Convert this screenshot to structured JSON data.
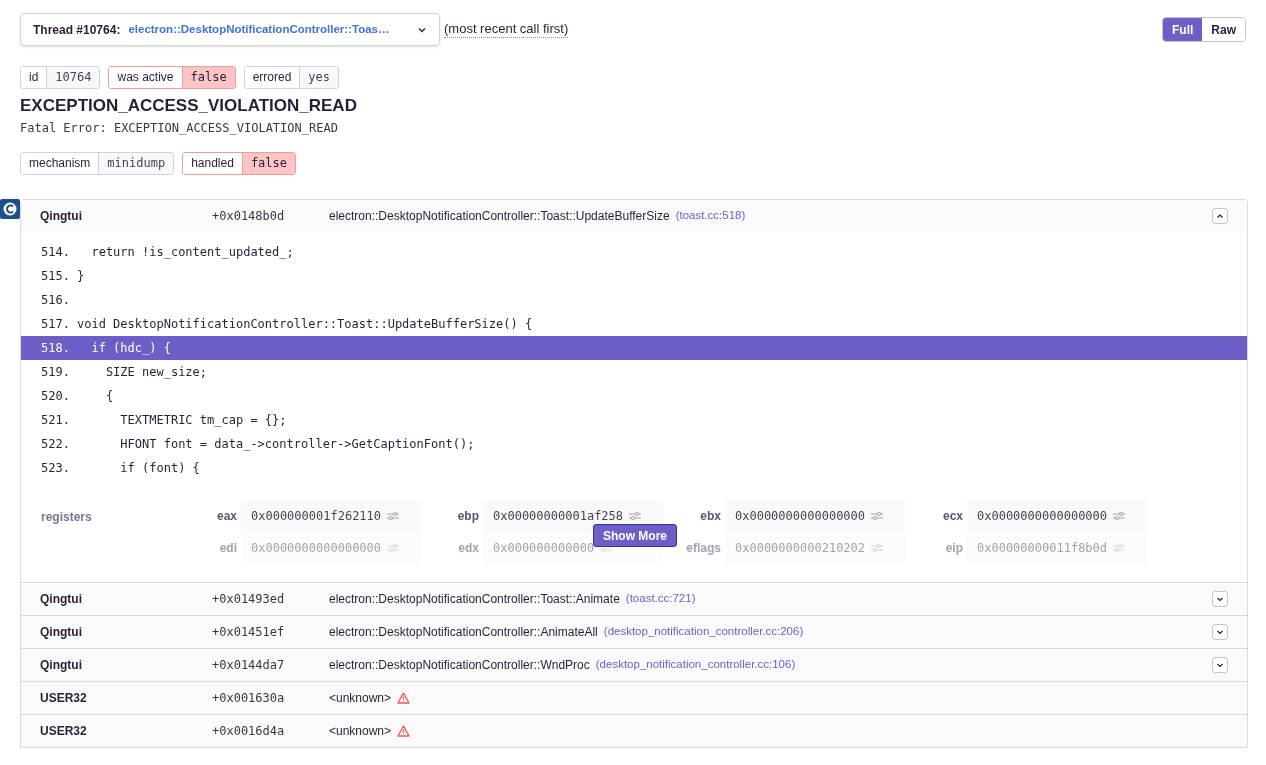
{
  "thread_selector": {
    "label": "Thread #10764:",
    "value": "electron::DesktopNotificationController::Toas…"
  },
  "order_note": "(most recent call first)",
  "view_toggle": [
    {
      "label": "Full",
      "selected": true
    },
    {
      "label": "Raw",
      "selected": false
    }
  ],
  "thread_tags": [
    {
      "key": "id",
      "value": "10764",
      "alert": false
    },
    {
      "key": "was active",
      "value": "false",
      "alert": true
    },
    {
      "key": "errored",
      "value": "yes",
      "alert": false
    }
  ],
  "exception": {
    "type": "EXCEPTION_ACCESS_VIOLATION_READ",
    "message": "Fatal Error: EXCEPTION_ACCESS_VIOLATION_READ"
  },
  "mechanism_tags": [
    {
      "key": "mechanism",
      "value": "minidump",
      "alert": false
    },
    {
      "key": "handled",
      "value": "false",
      "alert": true
    }
  ],
  "frames": [
    {
      "module": "Qingtui",
      "address": "+0x0148b0d",
      "function": "electron::DesktopNotificationController::Toast::UpdateBufferSize",
      "location": "(toast.cc:518)",
      "expanded": true,
      "unknown": false,
      "context": [
        {
          "line": "514.",
          "code": "  return !is_content_updated_;",
          "selected": false
        },
        {
          "line": "515.",
          "code": "}",
          "selected": false
        },
        {
          "line": "516.",
          "selected": false
        },
        {
          "line": "517.",
          "code": "void DesktopNotificationController::Toast::UpdateBufferSize() {",
          "selected": false
        },
        {
          "line": "518.",
          "code": "  if (hdc_) {",
          "selected": true
        },
        {
          "line": "519.",
          "code": "    SIZE new_size;",
          "selected": false
        },
        {
          "line": "520.",
          "code": "    {",
          "selected": false
        },
        {
          "line": "521.",
          "code": "      TEXTMETRIC tm_cap = {};",
          "selected": false
        },
        {
          "line": "522.",
          "code": "      HFONT font = data_->controller->GetCaptionFont();",
          "selected": false
        },
        {
          "line": "523.",
          "code": "      if (font) {",
          "selected": false
        }
      ],
      "registers_label": "registers",
      "registers": [
        {
          "name": "eax",
          "value": "0x000000001f262110",
          "dimmed": false
        },
        {
          "name": "ebp",
          "value": "0x00000000001af258",
          "dimmed": false
        },
        {
          "name": "ebx",
          "value": "0x0000000000000000",
          "dimmed": false
        },
        {
          "name": "ecx",
          "value": "0x0000000000000000",
          "dimmed": false
        },
        {
          "name": "edi",
          "value": "0x0000000000000000",
          "dimmed": true
        },
        {
          "name": "edx",
          "value": "0x000000000000",
          "dimmed": true
        },
        {
          "name": "eflags",
          "value": "0x0000000000210202",
          "dimmed": true
        },
        {
          "name": "eip",
          "value": "0x00000000011f8b0d",
          "dimmed": true
        }
      ],
      "show_more": "Show More"
    },
    {
      "module": "Qingtui",
      "address": "+0x01493ed",
      "function": "electron::DesktopNotificationController::Toast::Animate",
      "location": "(toast.cc:721)",
      "expanded": false,
      "unknown": false
    },
    {
      "module": "Qingtui",
      "address": "+0x01451ef",
      "function": "electron::DesktopNotificationController::AnimateAll",
      "location": "(desktop_notification_controller.cc:206)",
      "expanded": false,
      "unknown": false
    },
    {
      "module": "Qingtui",
      "address": "+0x0144da7",
      "function": "electron::DesktopNotificationController::WndProc",
      "location": "(desktop_notification_controller.cc:106)",
      "expanded": false,
      "unknown": false
    },
    {
      "module": "USER32",
      "address": "+0x001630a",
      "function": "<unknown>",
      "unknown": true
    },
    {
      "module": "USER32",
      "address": "+0x0016d4a",
      "function": "<unknown>",
      "unknown": true
    }
  ]
}
